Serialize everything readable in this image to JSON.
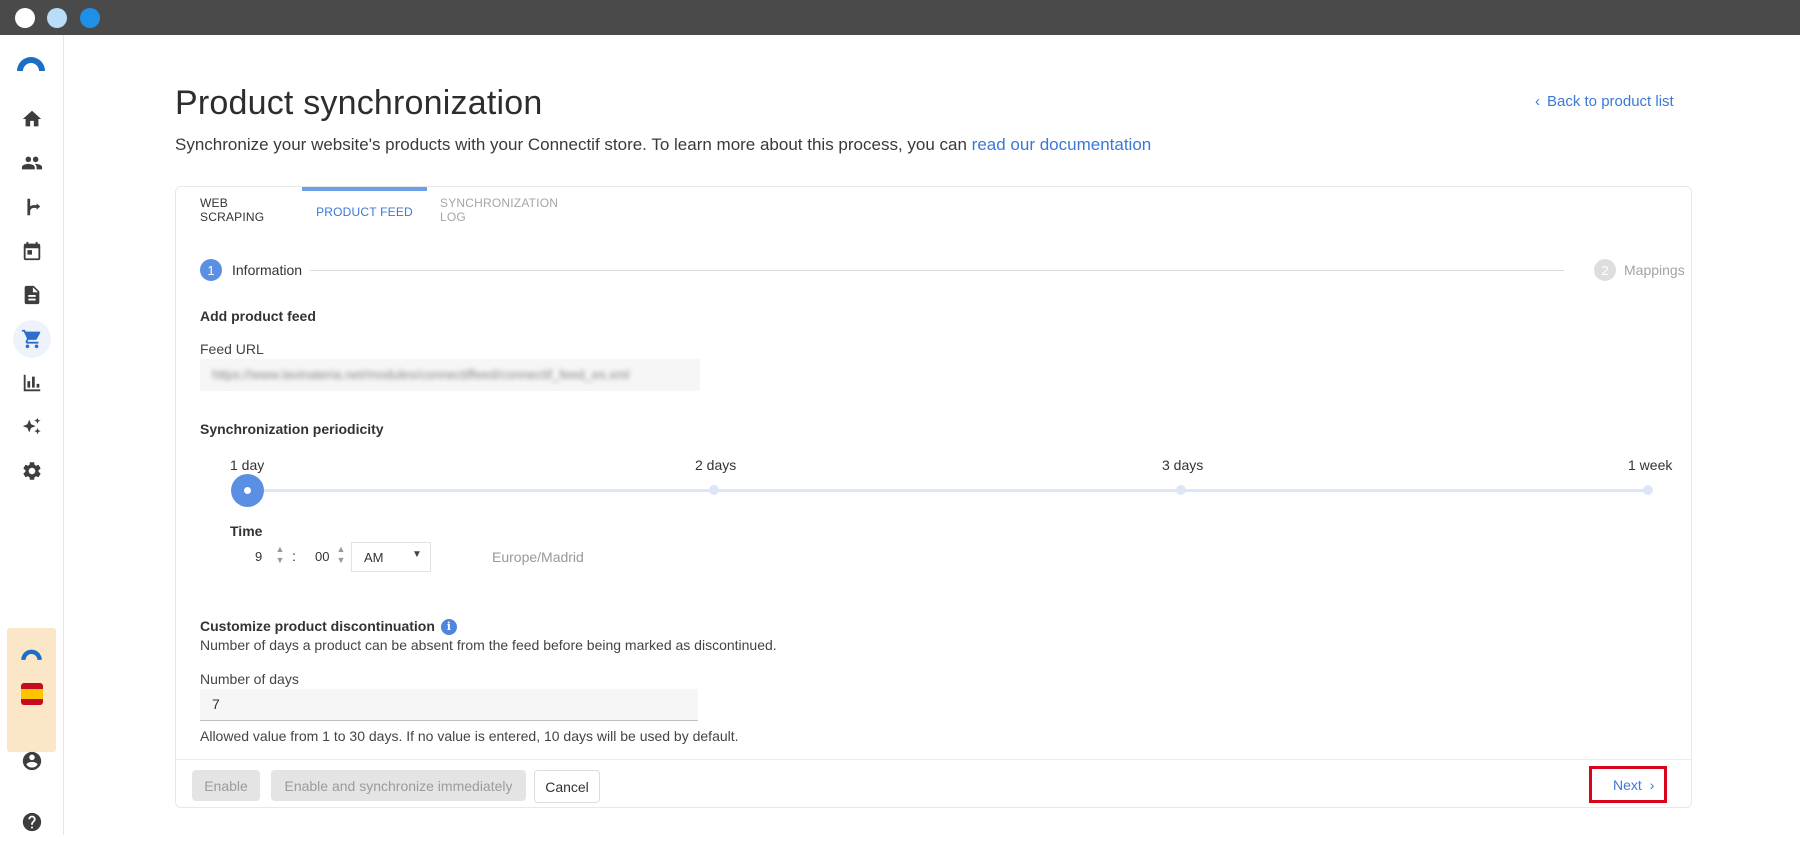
{
  "header": {
    "title": "Product synchronization",
    "subtitle_text": "Synchronize your website's products with your Connectif store. To learn more about this process, you can ",
    "subtitle_link": "read our documentation",
    "back_link": "Back to product list"
  },
  "tabs": [
    {
      "label": "WEB SCRAPING"
    },
    {
      "label": "PRODUCT FEED"
    },
    {
      "label": "SYNCHRONIZATION LOG"
    }
  ],
  "stepper": {
    "steps": [
      {
        "number": "1",
        "label": "Information"
      },
      {
        "number": "2",
        "label": "Mappings"
      }
    ]
  },
  "form": {
    "add_feed_title": "Add product feed",
    "feed_url_label": "Feed URL",
    "feed_url_value": "https://www.lavinateria.net/modules/connectiffeed/connectif_feed_es.xml",
    "periodicity_title": "Synchronization periodicity",
    "periodicity_options": [
      "1 day",
      "2 days",
      "3 days",
      "1 week"
    ],
    "periodicity_selected": "1 day",
    "time_label": "Time",
    "hour": "9",
    "separator": ":",
    "minute": "00",
    "ampm": "AM",
    "timezone": "Europe/Madrid",
    "discontinuation_title": "Customize product discontinuation",
    "discontinuation_desc": "Number of days a product can be absent from the feed before being marked as discontinued.",
    "days_label": "Number of days",
    "days_value": "7",
    "days_help": "Allowed value from 1 to 30 days. If no value is entered, 10 days will be used by default."
  },
  "footer": {
    "enable": "Enable",
    "enable_sync": "Enable and synchronize immediately",
    "cancel": "Cancel",
    "next": "Next"
  },
  "colors": {
    "accent": "#3b78d8",
    "highlight": "#d9041c",
    "titlebar": "#4a4a4a"
  }
}
